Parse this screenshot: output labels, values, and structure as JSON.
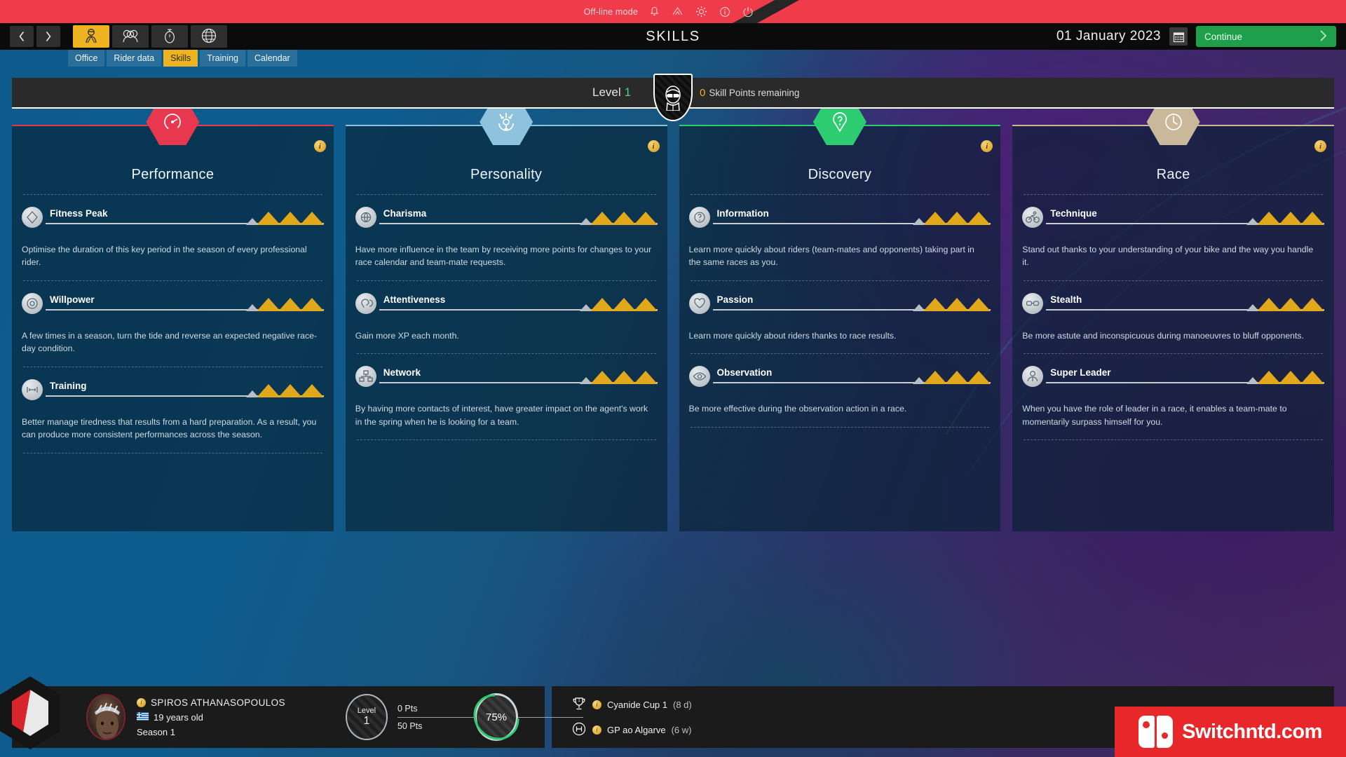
{
  "topbar": {
    "offline_label": "Off-line mode",
    "icons": [
      "bell-icon",
      "home-icon",
      "gear-icon",
      "info-icon",
      "power-icon"
    ]
  },
  "nav": {
    "back_icon": "chevron-left-icon",
    "forward_icon": "chevron-right-icon",
    "mode_icons": [
      "rider-icon",
      "team-icon",
      "stopwatch-icon",
      "globe-icon"
    ],
    "title": "SKILLS",
    "date": "01 January 2023",
    "calendar_icon": "calendar-icon",
    "continue_label": "Continue",
    "continue_icon": "chevron-right-icon",
    "continue_color": "#1f9e4b"
  },
  "tabs": [
    {
      "label": "Office",
      "active": false
    },
    {
      "label": "Rider data",
      "active": false
    },
    {
      "label": "Skills",
      "active": true
    },
    {
      "label": "Training",
      "active": false
    },
    {
      "label": "Calendar",
      "active": false
    }
  ],
  "level_strip": {
    "level_label": "Level",
    "level_value": "1",
    "points_value": "0",
    "points_label": "Skill Points remaining",
    "avatar_icon": "rider-shield-icon"
  },
  "columns": [
    {
      "title": "Performance",
      "accent": "#e8384f",
      "hex_icon": "speedometer-icon",
      "info_badge": "i",
      "skills": [
        {
          "name": "Fitness Peak",
          "icon": "diamond-icon",
          "filled": 3,
          "partial": 1,
          "desc": "Optimise the duration of this key period in the season of every professional rider."
        },
        {
          "name": "Willpower",
          "icon": "target-icon",
          "filled": 3,
          "partial": 1,
          "desc": "A few times in a season, turn the tide and reverse an expected negative race-day condition."
        },
        {
          "name": "Training",
          "icon": "dumbbell-icon",
          "filled": 3,
          "partial": 1,
          "desc": "Better manage tiredness that results from a hard preparation. As a result, you can produce more consistent performances across the season."
        }
      ]
    },
    {
      "title": "Personality",
      "accent": "#8fc2dd",
      "hex_icon": "influence-icon",
      "info_badge": "i",
      "skills": [
        {
          "name": "Charisma",
          "icon": "charisma-icon",
          "filled": 3,
          "partial": 1,
          "desc": "Have more influence in the team by receiving more points for changes to your race calendar and team-mate requests."
        },
        {
          "name": "Attentiveness",
          "icon": "ear-icon",
          "filled": 3,
          "partial": 1,
          "desc": "Gain more XP each month."
        },
        {
          "name": "Network",
          "icon": "network-icon",
          "filled": 3,
          "partial": 1,
          "desc": "By having more contacts of interest, have greater impact on the agent's work in the spring when he is looking for a team."
        }
      ]
    },
    {
      "title": "Discovery",
      "accent": "#2ecc71",
      "hex_icon": "question-pin-icon",
      "info_badge": "i",
      "skills": [
        {
          "name": "Information",
          "icon": "question-icon",
          "filled": 3,
          "partial": 1,
          "desc": "Learn more quickly about riders (team-mates and opponents) taking part in the same races as you."
        },
        {
          "name": "Passion",
          "icon": "heart-icon",
          "filled": 3,
          "partial": 1,
          "desc": "Learn more quickly about riders thanks to race results."
        },
        {
          "name": "Observation",
          "icon": "eye-icon",
          "filled": 3,
          "partial": 1,
          "desc": "Be more effective during the observation action in a race."
        }
      ]
    },
    {
      "title": "Race",
      "accent": "#c9b89a",
      "hex_icon": "clock-icon",
      "info_badge": "i",
      "skills": [
        {
          "name": "Technique",
          "icon": "cyclist-icon",
          "filled": 3,
          "partial": 1,
          "desc": "Stand out thanks to your understanding of your bike and the way you handle it."
        },
        {
          "name": "Stealth",
          "icon": "glasses-icon",
          "filled": 3,
          "partial": 1,
          "desc": "Be more astute and inconspicuous during manoeuvres to bluff opponents."
        },
        {
          "name": "Super Leader",
          "icon": "leader-icon",
          "filled": 3,
          "partial": 1,
          "desc": "When you have the role of leader in a race, it enables a team-mate to momentarily surpass himself for you."
        }
      ]
    }
  ],
  "player": {
    "jersey_icon": "jersey-icon",
    "avatar_icon": "rider-portrait",
    "name": "SPIROS ATHANASOPOULOS",
    "flag_icon": "greece-flag-icon",
    "age": "19 years old",
    "season": "Season 1",
    "level_label": "Level",
    "level_value": "1",
    "points_current": "0 Pts",
    "points_total": "50 Pts",
    "condition_pct": "75%"
  },
  "events": [
    {
      "icon": "trophy-icon",
      "name": "Cyanide Cup 1",
      "when": "(8 d)"
    },
    {
      "icon": "race-icon",
      "name": "GP ao Algarve",
      "when": "(6 w)"
    }
  ],
  "watermark": {
    "text": "Switchntd.com",
    "logo_icon": "switch-logo-icon",
    "color": "#e8272b"
  }
}
